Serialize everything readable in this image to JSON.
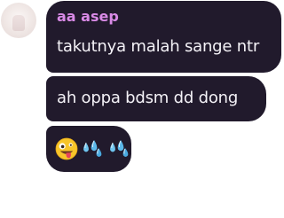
{
  "chat": {
    "avatar_icon": "user-avatar-icon",
    "messages": [
      {
        "sender": "aa asep",
        "sender_color": "#d98ae6",
        "text": "takutnya malah sange ntr"
      },
      {
        "text": "ah oppa bdsm dd dong"
      },
      {
        "emojis": [
          "zany-face-emoji",
          "sweat-droplets-emoji",
          "sweat-droplets-emoji"
        ]
      }
    ],
    "bubble_color": "#211a2c",
    "text_color": "#f4f2f7"
  }
}
